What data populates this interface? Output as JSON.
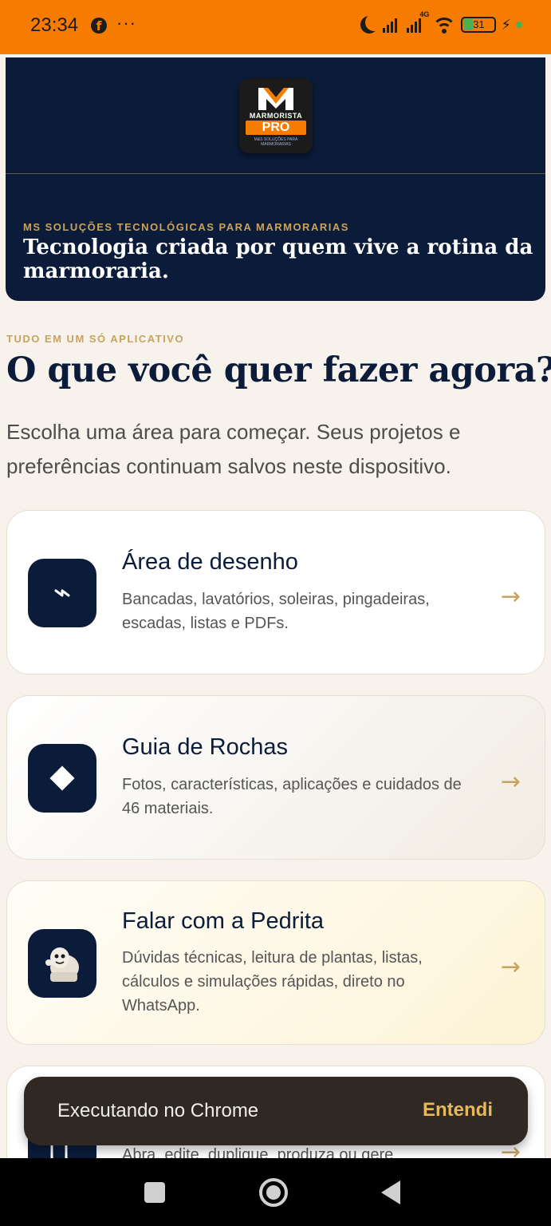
{
  "status_bar": {
    "time": "23:34",
    "dots": "···",
    "network_label": "4G",
    "battery": "31"
  },
  "hero": {
    "logo": {
      "name": "MARMORISTA",
      "pro": "PRO",
      "tagline": "M&S SOLUÇÕES PARA MARMORARIAS"
    },
    "kicker": "MS SOLUÇÕES TECNOLÓGICAS PARA MARMORARIAS",
    "tagline": "Tecnologia criada por quem vive a rotina da marmoraria."
  },
  "intro": {
    "kicker": "TUDO EM UM SÓ APLICATIVO",
    "headline": "O que você quer fazer agora?",
    "subtitle": "Escolha uma área para começar. Seus projetos e preferências continuam salvos neste dispositivo."
  },
  "cards": [
    {
      "title": "Área de desenho",
      "description": "Bancadas, lavatórios, soleiras, pingadeiras, escadas, listas e PDFs.",
      "icon": "lightning-icon",
      "arrow": "→"
    },
    {
      "title": "Guia de Rochas",
      "description": "Fotos, características, aplicações e cuidados de 46 materiais.",
      "icon": "diamond-icon",
      "arrow": "→"
    },
    {
      "title": "Falar com a Pedrita",
      "description": "Dúvidas técnicas, leitura de plantas, listas, cálculos e simulações rápidas, direto no WhatsApp.",
      "icon": "pedrita-mascot-icon",
      "arrow": "→"
    },
    {
      "title": "",
      "description": "Abra, edite, duplique, produza ou gere",
      "icon": "projects-icon",
      "arrow": "→"
    }
  ],
  "toast": {
    "message": "Executando no Chrome",
    "action": "Entendi"
  },
  "colors": {
    "status_bar": "#f57c00",
    "navy": "#0b1c3a",
    "gold": "#c9a35e",
    "background": "#f7f3ec"
  }
}
